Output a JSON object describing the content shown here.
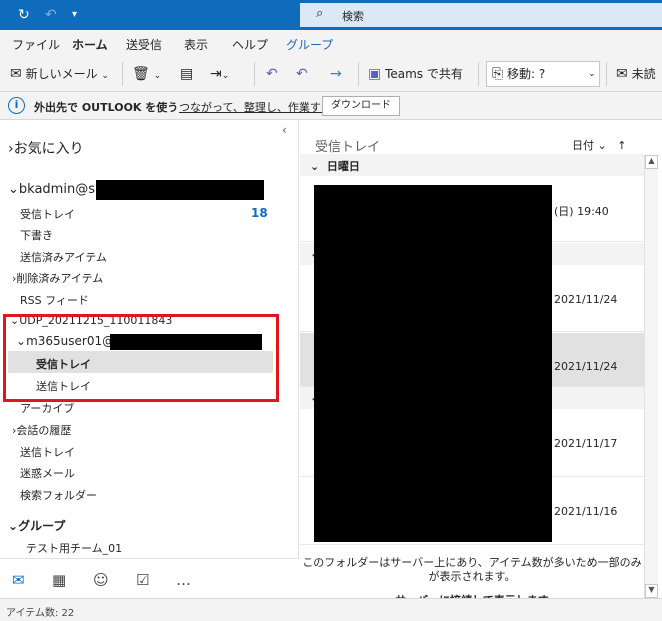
{
  "titlebar": {
    "sync_icon": "sync-icon",
    "undo_icon": "undo-icon",
    "customize_icon": "customize-icon",
    "search_placeholder": "検索"
  },
  "tabs": [
    "ファイル",
    "ホーム",
    "送受信",
    "表示",
    "ヘルプ",
    "グループ"
  ],
  "ribbon": {
    "new_mail": "新しいメール",
    "teams_share": "Teams で共有",
    "move": "移動: ?",
    "unread": "未読"
  },
  "infobar": {
    "message": "外出先で OUTLOOK を使う",
    "link": "つながって、整理し、作業する",
    "download": "ダウンロード"
  },
  "folders": {
    "favorites": "お気に入り",
    "account1": "bkadmin@s",
    "inbox": "受信トレイ",
    "inbox_count": "18",
    "drafts": "下書き",
    "sent": "送信済みアイテム",
    "deleted": "削除済みアイテム",
    "rss": "RSS フィード",
    "udp": "UDP_20211215_110011843",
    "account2": "m365user01@",
    "udp_inbox": "受信トレイ",
    "udp_outbox": "送信トレイ",
    "archive": "アーカイブ",
    "history": "会話の履歴",
    "outbox": "送信トレイ",
    "junk": "迷惑メール",
    "search_folders": "検索フォルダー",
    "groups": "グループ",
    "test_team": "テスト用チーム_01"
  },
  "list": {
    "title": "受信トレイ",
    "sort": "日付",
    "group_sunday": "日曜日",
    "dates": [
      "(日) 19:40",
      "2021/11/24",
      "2021/11/24",
      "2021/11/17",
      "2021/11/16"
    ],
    "notice": "このフォルダーはサーバー上にあり、アイテム数が多いため一部のみが表示されます。",
    "connect": "サーバーに接続して表示します"
  },
  "status": {
    "item_count": "アイテム数: 22"
  }
}
